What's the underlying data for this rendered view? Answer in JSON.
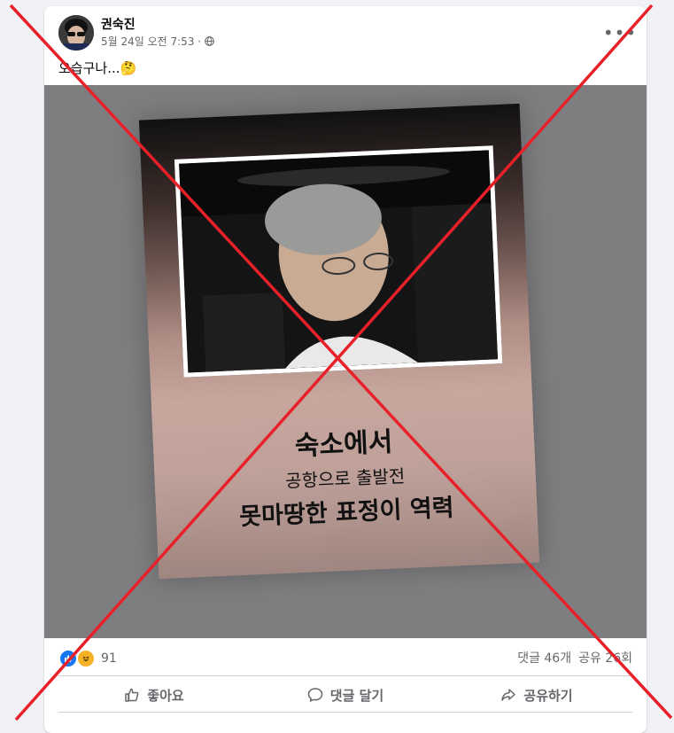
{
  "post": {
    "author": "권숙진",
    "timestamp": "5월 24일 오전 7:53 ·",
    "privacy_icon": "globe-icon",
    "text": "오습구나...🤔",
    "more_icon": "more-options-icon"
  },
  "image": {
    "lines": [
      "숙소에서",
      "공항으로 출발전",
      "못마땅한 표정이 역력"
    ]
  },
  "reactions": {
    "icons": [
      "like-icon",
      "haha-icon"
    ],
    "count": "91",
    "comments": "댓글 46개",
    "shares": "공유 26회"
  },
  "actions": {
    "like": "좋아요",
    "comment": "댓글 달기",
    "share": "공유하기"
  },
  "colors": {
    "like_blue": "#1877f2",
    "haha_yellow": "#f7b125",
    "cross_red": "#e8202a"
  }
}
